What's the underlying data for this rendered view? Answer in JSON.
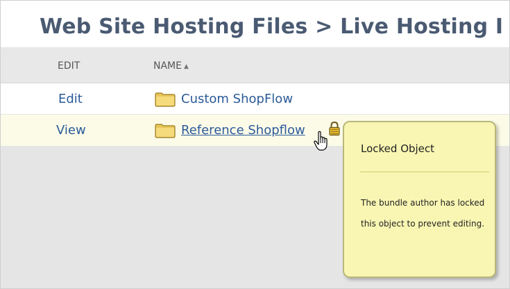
{
  "page": {
    "title": "Web Site Hosting Files > Live Hosting I"
  },
  "table": {
    "headers": {
      "edit": "EDIT",
      "name": "NAME"
    },
    "sort_icon": "sort-ascending-icon",
    "rows": [
      {
        "action": "Edit",
        "name": "Custom ShopFlow",
        "icon": "folder-icon"
      },
      {
        "action": "View",
        "name": "Reference Shopflow",
        "icon": "folder-icon",
        "locked": true
      }
    ]
  },
  "tooltip": {
    "title": "Locked Object",
    "body": "The bundle author has locked this object to prevent editing."
  },
  "colors": {
    "title": "#4a5a72",
    "link": "#2a5a98",
    "tooltip_bg": "#f9f6b3",
    "tooltip_border": "#b9b77a",
    "folder": "#e8c65a",
    "highlight_row": "#fbfbe8"
  }
}
